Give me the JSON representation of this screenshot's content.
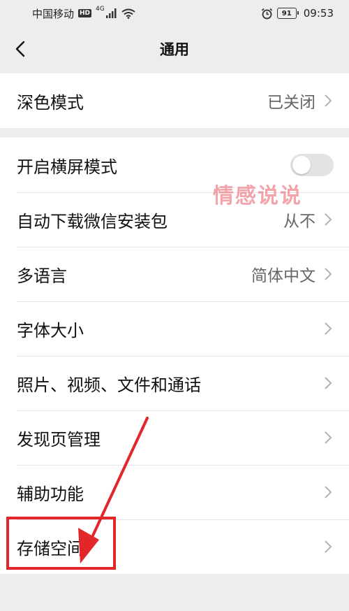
{
  "status_bar": {
    "carrier": "中国移动",
    "hd_badge": "HD",
    "network_type": "4G",
    "battery_level": "91",
    "time": "09:53",
    "icons": [
      "signal-icon",
      "wifi-icon",
      "alarm-icon",
      "battery-icon"
    ]
  },
  "nav": {
    "title": "通用",
    "back_icon": "chevron-left-icon"
  },
  "group1": {
    "items": [
      {
        "label": "深色模式",
        "value": "已关闭"
      }
    ]
  },
  "group2": {
    "items": [
      {
        "label": "开启横屏模式",
        "toggle": false
      },
      {
        "label": "自动下载微信安装包",
        "value": "从不"
      },
      {
        "label": "多语言",
        "value": "简体中文"
      },
      {
        "label": "字体大小"
      },
      {
        "label": "照片、视频、文件和通话"
      },
      {
        "label": "发现页管理"
      },
      {
        "label": "辅助功能"
      },
      {
        "label": "存储空间"
      }
    ]
  },
  "watermark": "情感说说",
  "annotation": {
    "color": "#e2262a",
    "target": "存储空间"
  },
  "colors": {
    "background": "#ededed",
    "row_background": "#ffffff",
    "annotation_red": "#e2262a"
  }
}
